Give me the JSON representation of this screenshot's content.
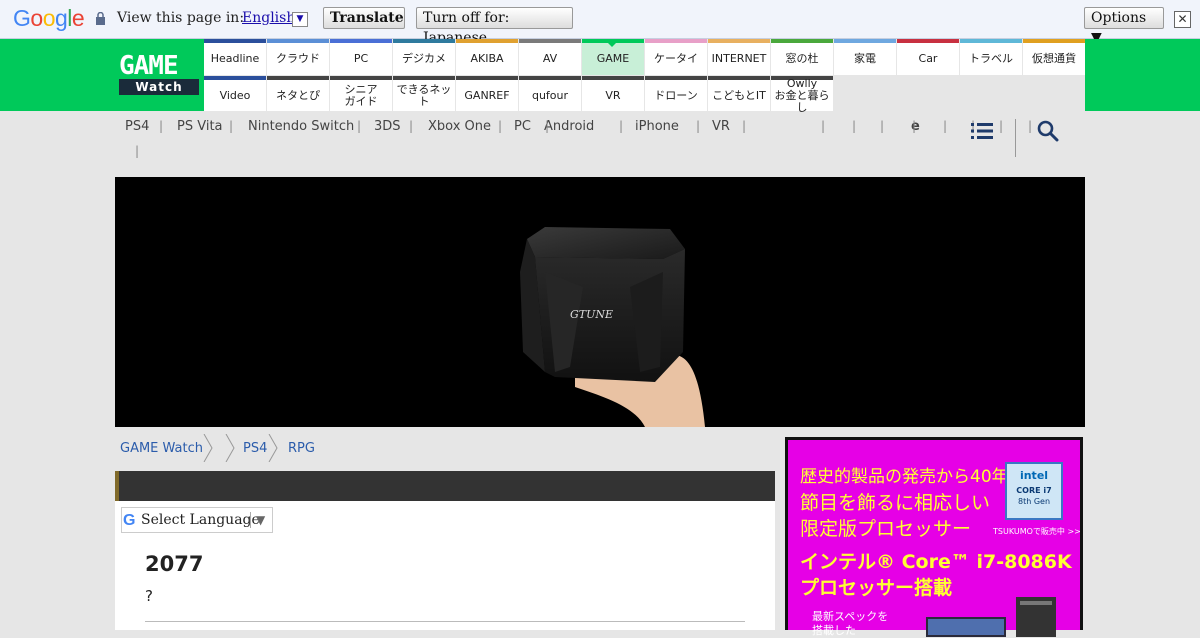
{
  "translate_bar": {
    "logo_letters": [
      "G",
      "o",
      "o",
      "g",
      "l",
      "e"
    ],
    "logo_colors": [
      "#4285f4",
      "#ea4335",
      "#fbbc05",
      "#4285f4",
      "#34a853",
      "#ea4335"
    ],
    "prompt": "View this page in:",
    "language": "English",
    "translate_button": "Translate",
    "turn_off_button": "Turn off for: Japanese",
    "options_button": "Options ▼",
    "close": "✕"
  },
  "site_logo": {
    "top": "GAME",
    "bottom": "Watch"
  },
  "nav_row1": [
    {
      "label": "Headline",
      "color": "#2b4f9c"
    },
    {
      "label": "クラウド",
      "color": "#5b8fd6"
    },
    {
      "label": "PC",
      "color": "#4a6fd6"
    },
    {
      "label": "デジカメ",
      "color": "#2e7a9e"
    },
    {
      "label": "AKIBA",
      "color": "#e0a130"
    },
    {
      "label": "AV",
      "color": "#7a7a7a"
    },
    {
      "label": "GAME",
      "color": "#00c95a"
    },
    {
      "label": "ケータイ",
      "color": "#e8a0c8"
    },
    {
      "label": "INTERNET",
      "color": "#e8b060"
    },
    {
      "label": "窓の杜",
      "color": "#4aa83c"
    },
    {
      "label": "家電",
      "color": "#6fa8e0"
    },
    {
      "label": "Car",
      "color": "#c83040"
    },
    {
      "label": "トラベル",
      "color": "#5fb8d8"
    },
    {
      "label": "仮想通貨",
      "color": "#e0a020"
    }
  ],
  "nav_row2": [
    {
      "label": "Video",
      "color": "#2b4f9c"
    },
    {
      "label": "ネタとぴ",
      "color": "#444444"
    },
    {
      "label": "シニア\nガイド",
      "color": "#444444"
    },
    {
      "label": "できるネット",
      "color": "#444444"
    },
    {
      "label": "GANREF",
      "color": "#444444"
    },
    {
      "label": "qufour",
      "color": "#444444"
    },
    {
      "label": "VR",
      "color": "#444444"
    },
    {
      "label": "ドローン",
      "color": "#444444"
    },
    {
      "label": "こどもとIT",
      "color": "#444444"
    },
    {
      "label": "Owlly\nお金と暮らし",
      "color": "#444444"
    }
  ],
  "categories": [
    "PS4",
    "PS Vita",
    "Nintendo Switch",
    "3DS",
    "Xbox One",
    "PC",
    "Android",
    "iPhone",
    "VR",
    "",
    "",
    "e",
    "",
    "",
    "",
    ""
  ],
  "hero": {
    "brand": "GTUNE"
  },
  "breadcrumb": [
    "GAME Watch",
    "",
    "PS4",
    "RPG"
  ],
  "select_language": {
    "g": "G",
    "label": "Select Language",
    "caret": "▼"
  },
  "article": {
    "title": "2077",
    "subtitle": "?"
  },
  "ad": {
    "line1": "歴史的製品の発売から40年",
    "line2": "節目を飾るに相応しい",
    "line3": "限定版プロセッサー",
    "big1": "インテル® Core™ i7-8086K",
    "big2": "プロセッサー搭載",
    "small1": "最新スペックを",
    "small2": "搭載した",
    "chip_brand": "intel",
    "chip_line1": "CORE i7",
    "chip_line2": "8th Gen",
    "tsukumo": "TSUKUMOで販売中 >>"
  },
  "colors": {
    "accent_green": "#00c95a",
    "ad_bg": "#e600e6",
    "ad_text": "#ffff33"
  }
}
